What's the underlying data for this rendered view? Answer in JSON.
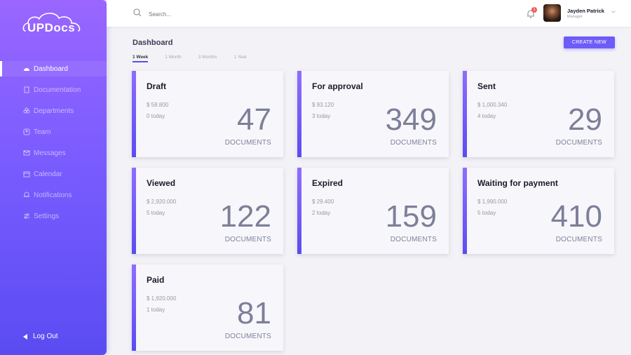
{
  "app": {
    "logo_text": "UPDocs"
  },
  "sidebar": {
    "items": [
      {
        "label": "Dashboard",
        "icon": "dashboard-icon",
        "active": true
      },
      {
        "label": "Documentation",
        "icon": "document-icon"
      },
      {
        "label": "Departments",
        "icon": "departments-icon"
      },
      {
        "label": "Team",
        "icon": "team-icon"
      },
      {
        "label": "Messages",
        "icon": "mail-icon"
      },
      {
        "label": "Calendar",
        "icon": "calendar-icon"
      },
      {
        "label": "Notifications",
        "icon": "bell-icon"
      },
      {
        "label": "Settings",
        "icon": "settings-icon"
      }
    ],
    "logout_label": "Log Out"
  },
  "header": {
    "search_placeholder": "Search...",
    "notification_count": "1",
    "user": {
      "name": "Jayden Patrick",
      "role": "Manager"
    }
  },
  "main": {
    "title": "Dashboard",
    "tabs": [
      {
        "label": "1 Week",
        "active": true
      },
      {
        "label": "1 Month"
      },
      {
        "label": "3 Months"
      },
      {
        "label": "1 Year"
      }
    ],
    "create_label": "CREATE NEW",
    "cards": [
      {
        "title": "Draft",
        "amount": "$ 58.800",
        "today": "0 today",
        "count": "47",
        "unit": "DOCUMENTS"
      },
      {
        "title": "For approval",
        "amount": "$ 93.120",
        "today": "3 today",
        "count": "349",
        "unit": "DOCUMENTS"
      },
      {
        "title": "Sent",
        "amount": "$ 1,000.340",
        "today": "4 today",
        "count": "29",
        "unit": "DOCUMENTS"
      },
      {
        "title": "Viewed",
        "amount": "$ 2,920.000",
        "today": "5 today",
        "count": "122",
        "unit": "DOCUMENTS"
      },
      {
        "title": "Expired",
        "amount": "$ 29.400",
        "today": "2 today",
        "count": "159",
        "unit": "DOCUMENTS"
      },
      {
        "title": "Waiting for payment",
        "amount": "$ 1,990.000",
        "today": "5 today",
        "count": "410",
        "unit": "DOCUMENTS"
      },
      {
        "title": "Paid",
        "amount": "$ 1,920.000",
        "today": "1 today",
        "count": "81",
        "unit": "DOCUMENTS"
      }
    ]
  },
  "colors": {
    "accent": "#6d5cf7",
    "sidebar_top": "#9a66ff",
    "sidebar_bottom": "#5a4cf2",
    "badge": "#f0595b"
  }
}
